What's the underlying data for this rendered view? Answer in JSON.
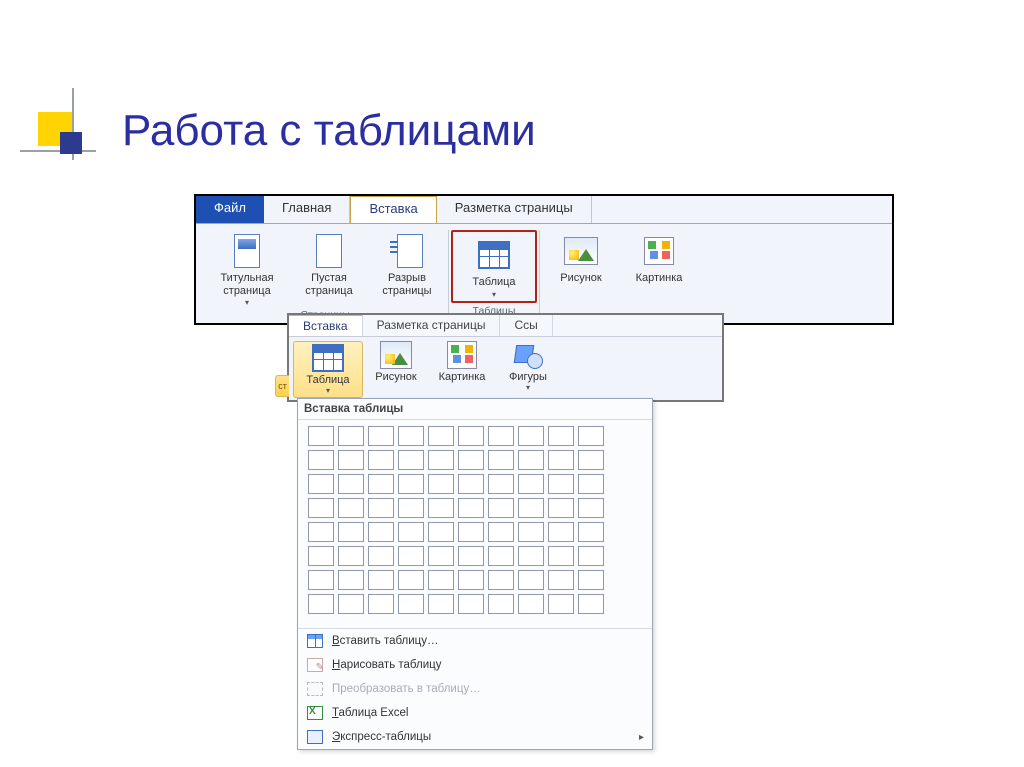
{
  "slide": {
    "title": "Работа с таблицами"
  },
  "ribbon1": {
    "tabs": {
      "file": "Файл",
      "home": "Главная",
      "insert": "Вставка",
      "layout": "Разметка страницы"
    },
    "pages_group": {
      "cover": "Титульная\nстраница",
      "blank": "Пустая\nстраница",
      "break": "Разрыв\nстраницы",
      "label": "Страницы"
    },
    "tables_group": {
      "table": "Таблица",
      "label": "Таблицы"
    },
    "illus": {
      "picture": "Рисунок",
      "clipart": "Картинка"
    }
  },
  "ribbon2": {
    "tabs": {
      "insert": "Вставка",
      "layout": "Разметка страницы",
      "refs": "Ссы"
    },
    "items": {
      "table": "Таблица",
      "picture": "Рисунок",
      "clipart": "Картинка",
      "shapes": "Фигуры"
    },
    "side_tab": "ст"
  },
  "dropdown": {
    "header": "Вставка таблицы",
    "grid": {
      "rows": 8,
      "cols": 10
    },
    "menu": {
      "insert": "Вставить таблицу…",
      "draw": "Нарисовать таблицу",
      "convert": "Преобразовать в таблицу…",
      "excel": "Таблица Excel",
      "quick": "Экспресс-таблицы"
    }
  }
}
